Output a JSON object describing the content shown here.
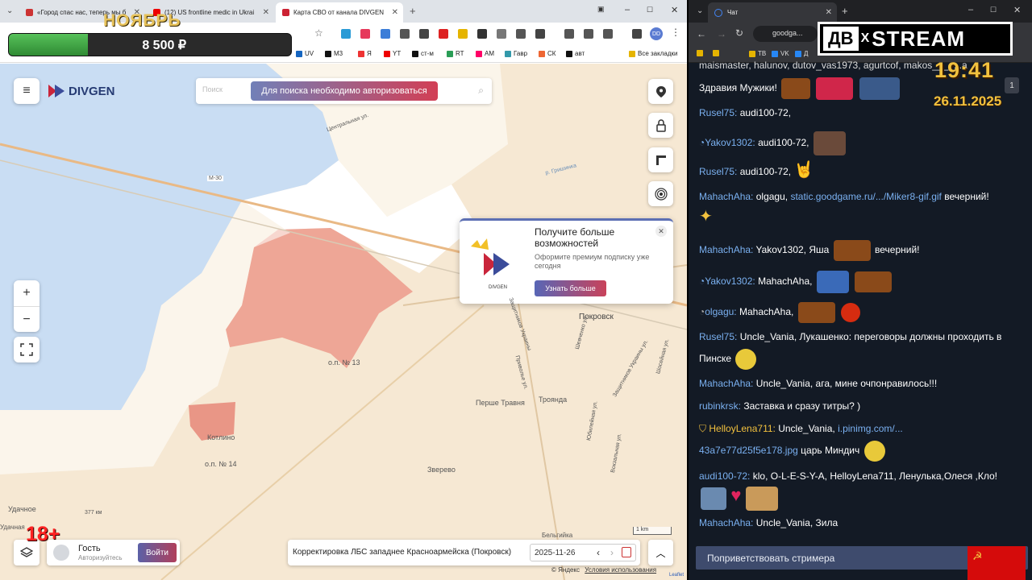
{
  "left_browser": {
    "tabs": [
      {
        "title": "«Город спас нас, теперь мы б",
        "fav_color": "#c33"
      },
      {
        "title": "(12) US frontline medic in Ukrai",
        "fav_color": "#e00"
      },
      {
        "title": "Карта СВО от канала DIVGEN",
        "fav_color": "#c23",
        "active": true
      }
    ],
    "new_tab": "+",
    "bookmarks": [
      "UV",
      "M3",
      "Я",
      "YT",
      "ст-м",
      "RT",
      "AM",
      "Гавр",
      "СК",
      "авт",
      "Все закладки"
    ],
    "profile": "DD"
  },
  "overlay": {
    "month": "НОЯБРЬ",
    "donation_amount": "8 500 ₽",
    "donation_progress": 0.28,
    "age_rating": "18+"
  },
  "map": {
    "logo": "DIVGEN",
    "search_placeholder": "Поиск",
    "search_button": "Для поиска необходимо авторизоваться",
    "promo": {
      "title": "Получите больше возможностей",
      "subtitle": "Оформите премиум подписку уже сегодня",
      "button": "Узнать больше",
      "logo_text": "DIVGEN"
    },
    "zoom_in": "+",
    "zoom_out": "−",
    "places": [
      {
        "name": "Покровск",
        "big": true
      },
      {
        "name": "о.п. № 13"
      },
      {
        "name": "Перше Травня"
      },
      {
        "name": "Троянда"
      },
      {
        "name": "Котлино"
      },
      {
        "name": "о.п. № 14"
      },
      {
        "name": "Зверево"
      },
      {
        "name": "Удачное"
      },
      {
        "name": "377 км"
      },
      {
        "name": "Удачная"
      },
      {
        "name": "Бельгийка"
      },
      {
        "name": "М-30"
      },
      {
        "name": "Центральная ул."
      },
      {
        "name": "р. Гришинка"
      },
      {
        "name": "Защитников Украины ул."
      },
      {
        "name": "Шевченко ул."
      },
      {
        "name": "Шосейная ул."
      },
      {
        "name": "Вокзальная ул."
      },
      {
        "name": "Приволье ул."
      },
      {
        "name": "Юбилейная ул."
      },
      {
        "name": "Защитников Украины"
      }
    ],
    "scale": "1 km",
    "copyright": "© Яндекс",
    "terms": "Условия использования",
    "leaflet": "Leaflet",
    "guest": {
      "name": "Гость",
      "status": "Авторизуйтесь",
      "login": "Войти"
    },
    "news_title": "Корректировка ЛБС западнее Красноармейска (Покровск)",
    "date": "2025-11-26"
  },
  "right_browser": {
    "tab_title": "Чат",
    "url": "goodga...",
    "bookmarks": [
      "TB",
      "VK",
      "Д"
    ]
  },
  "stream": {
    "logo_left": "ДВ",
    "logo_x": "X",
    "logo_right": "STREAM",
    "time": "19:41",
    "date": "26.11.2025"
  },
  "chat": [
    {
      "nick": "",
      "text": "maismaster, halunov, dutov_vas1973, agurtcof, makos___, ...a"
    },
    {
      "nick": "",
      "text": "Здравия Мужики!"
    },
    {
      "nick": "Rusel75:",
      "text": "audi100-72,"
    },
    {
      "nick": "Yakov1302:",
      "text": "audi100-72,"
    },
    {
      "nick": "Rusel75:",
      "text": "audi100-72,"
    },
    {
      "nick": "MahachAha:",
      "text": "olgagu,",
      "link": "static.goodgame.ru/.../Miker8-gif.gif",
      "text2": "вечерний!"
    },
    {
      "nick": "MahachAha:",
      "text": "Yakov1302, Яша",
      "text2": "вечерний!"
    },
    {
      "nick": "Yakov1302:",
      "text": "MahachAha,"
    },
    {
      "nick": "olgagu:",
      "text": "MahachAha,"
    },
    {
      "nick": "Rusel75:",
      "text": "Uncle_Vania, Лукашенко: переговоры должны проходить в",
      "text2": "Пинске"
    },
    {
      "nick": "MahachAha:",
      "text": "Uncle_Vania, ага, мине очпонравилось!!!"
    },
    {
      "nick": "rubinkrsk:",
      "text": "Заставка и сразу титры? )"
    },
    {
      "nick": "HelloyLena711:",
      "text": "Uncle_Vania,",
      "link": "i.pinimg.com/...",
      "link2": "43a7e77d25f5e178.jpg",
      "text2": "царь Миндич"
    },
    {
      "nick": "audi100-72:",
      "text": "klo, O-L-E-S-Y-A, HelloyLena711, Ленулька,Олеся ,Кло!"
    },
    {
      "nick": "MahachAha:",
      "text": "Uncle_Vania, Зила"
    }
  ],
  "greet_button": "Поприветствовать стримера"
}
